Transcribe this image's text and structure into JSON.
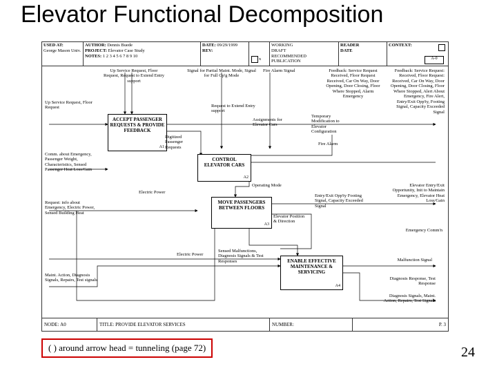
{
  "title": "Elevator Functional Decomposition",
  "header": {
    "used_at_label": "USED AT:",
    "used_at": "George Mason Univ.",
    "author_label": "AUTHOR:",
    "author": "Dennis Buede",
    "project_label": "PROJECT:",
    "project": "Elevator Case Study",
    "notes_label": "NOTES:",
    "notes": "1 2 3 4 5 6 7 8 9 10",
    "date_label": "DATE:",
    "date": "09/29/1999",
    "rev_label": "REV:",
    "working": "WORKING",
    "draft": "DRAFT",
    "recommended": "RECOMMENDED",
    "publication": "PUBLICATION",
    "reader": "READER",
    "date2": "DATE",
    "context": "CONTEXT:",
    "a0": "A-0",
    "draft_x": "x"
  },
  "boxes": {
    "a1": {
      "label": "ACCEPT PASSENGER REQUESTS & PROVIDE FEEDBACK",
      "id": "A1"
    },
    "a2": {
      "label": "CONTROL ELEVATOR CARS",
      "id": "A2"
    },
    "a3": {
      "label": "MOVE PASSENGERS BETWEEN FLOORS",
      "id": "A3"
    },
    "a4": {
      "label": "ENABLE EFFECTIVE MAINTENANCE & SERVICING",
      "id": "A4"
    }
  },
  "labels": {
    "l_upservice": "Up Service Request, Floor Request, Request to Extend Entry support",
    "l_upservice2": "Up Service Request, Floor Request",
    "l_signalmaint": "Signal for Partial Maint. Mode, Signal for Full Op'g Mode",
    "l_firealarm": "Fire Alarm Signal",
    "l_feedback": "Feedback: Service Request Received, Floor Request Received, Car On Way, Door Opening, Door Closing, Floor Where Stopped, Alarm Emergency",
    "l_feedback2": "Feedback: Service Request: Received, Floor Request: Received, Car On Way, Door Opening, Door Closing, Floor Where Stopped, Alert About Emergency, Fire Alert, Entry/Exit Opp'ty, Footing Signal, Capacity Exceeded Signal",
    "l_comm": "Comm. about Emergency, Passenger Weight, Characteristics, Sensed Passenger Heat Loss/Gain",
    "l_digitized": "Digitized Passenger Requests",
    "l_reqextend": "Request to Extend Entry support",
    "l_assignments": "Assignments for Elevator Cars",
    "l_tempmod": "Temporary Modification to Elevator Configuration",
    "l_firealarm2": "Fire Alarm",
    "l_req_info": "Request: info about Emergency, Electric Power, Sensed Building Heat",
    "l_electric": "Electric Power",
    "l_opmode": "Operating Mode",
    "l_elevpos": "Elevator Position & Direction",
    "l_entryexit": "Entry/Exit Opp'ty Footing Signal, Capacity Exceeded Signal",
    "l_entryexit2": "Elevator Entry/Exit Opportunity, Init to Maintain Emergency, Elevator Heat Loss/Gain",
    "l_electric2": "Electric Power",
    "l_sensed": "Sensed Malfunctions, Diagnosis Signals & Test Responses",
    "l_emcomm": "Emergency Comm'n",
    "l_maint": "Maint. Action, Diagnosis Signals, Repairs, Test signals",
    "l_malfn": "Malfunction Signal",
    "l_diagresp": "Diagnosis Response, Test Response",
    "l_diagsig": "Diagnosis Signals, Maint. Action, Repairs, Test Signals"
  },
  "footer": {
    "node_label": "NODE:",
    "node": "A0",
    "title_label": "TITLE:",
    "title": "PROVIDE ELEVATOR SERVICES",
    "number_label": "NUMBER:",
    "page": "P. 3"
  },
  "footnote": "( ) around arrow head = tunneling (page 72)",
  "pagenum": "24"
}
